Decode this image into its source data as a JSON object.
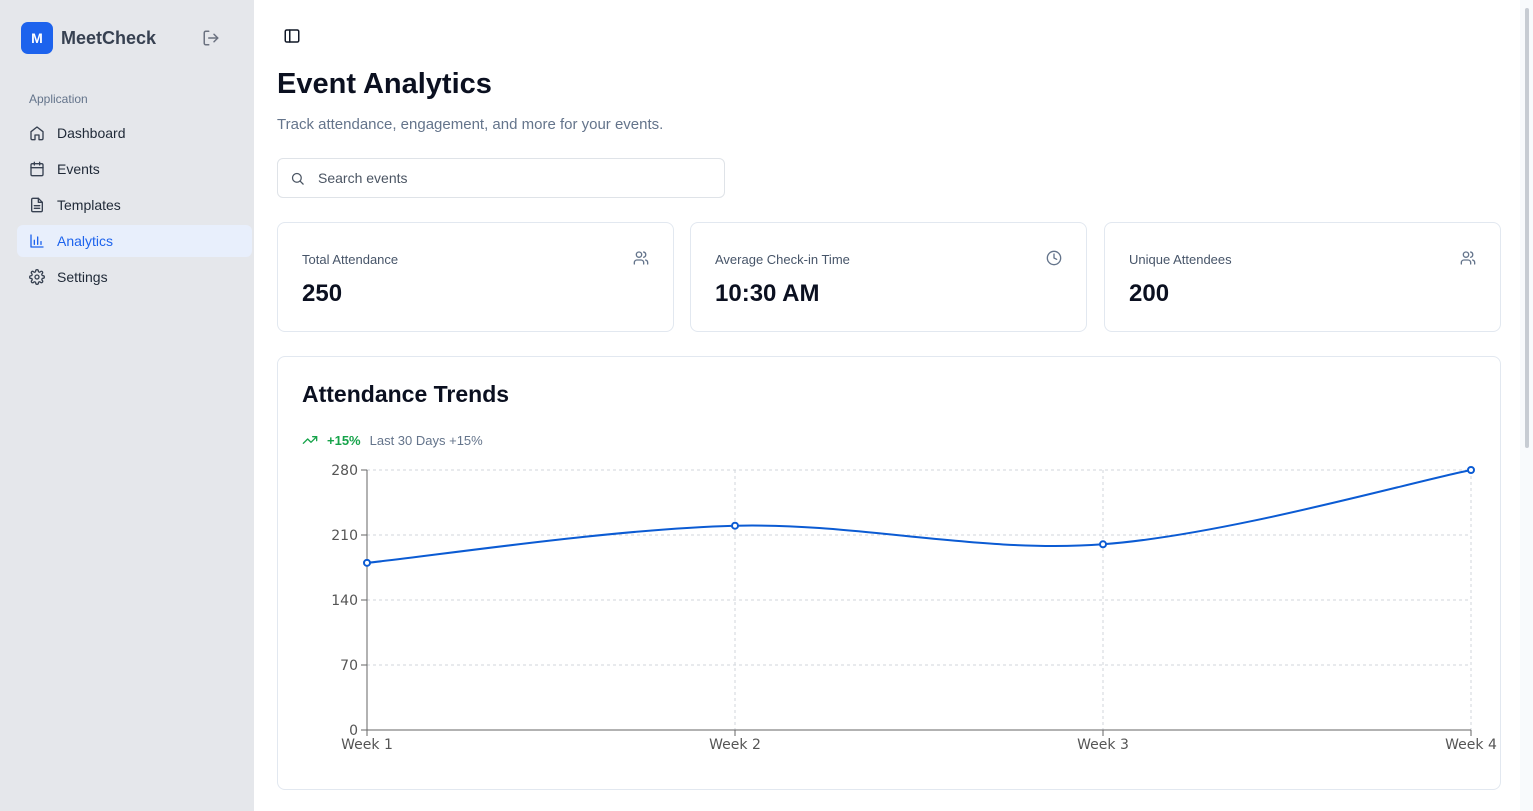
{
  "app": {
    "logo_letter": "M",
    "name": "MeetCheck"
  },
  "sidebar": {
    "section_label": "Application",
    "items": [
      {
        "label": "Dashboard",
        "icon": "home-icon"
      },
      {
        "label": "Events",
        "icon": "calendar-icon"
      },
      {
        "label": "Templates",
        "icon": "file-icon"
      },
      {
        "label": "Analytics",
        "icon": "bar-chart-icon",
        "active": true
      },
      {
        "label": "Settings",
        "icon": "gear-icon"
      }
    ]
  },
  "header": {
    "title": "Event Analytics",
    "subtitle": "Track attendance, engagement, and more for your events."
  },
  "search": {
    "placeholder": "Search events",
    "value": ""
  },
  "stats": [
    {
      "label": "Total Attendance",
      "value": "250",
      "icon": "users-icon"
    },
    {
      "label": "Average Check-in Time",
      "value": "10:30 AM",
      "icon": "clock-icon"
    },
    {
      "label": "Unique Attendees",
      "value": "200",
      "icon": "users-icon"
    }
  ],
  "trends": {
    "title": "Attendance Trends",
    "change": "+15%",
    "change_text": "Last 30 Days +15%"
  },
  "colors": {
    "accent": "#1d63ed",
    "line": "#0b5bd3",
    "positive": "#16a34a",
    "sidebar_bg": "#e5e7eb"
  },
  "chart_data": {
    "type": "line",
    "title": "Attendance Trends",
    "categories": [
      "Week 1",
      "Week 2",
      "Week 3",
      "Week 4"
    ],
    "values": [
      180,
      220,
      200,
      280
    ],
    "ylim": [
      0,
      280
    ],
    "yticks": [
      0,
      70,
      140,
      210,
      280
    ],
    "grid": true,
    "curve": "smooth"
  }
}
